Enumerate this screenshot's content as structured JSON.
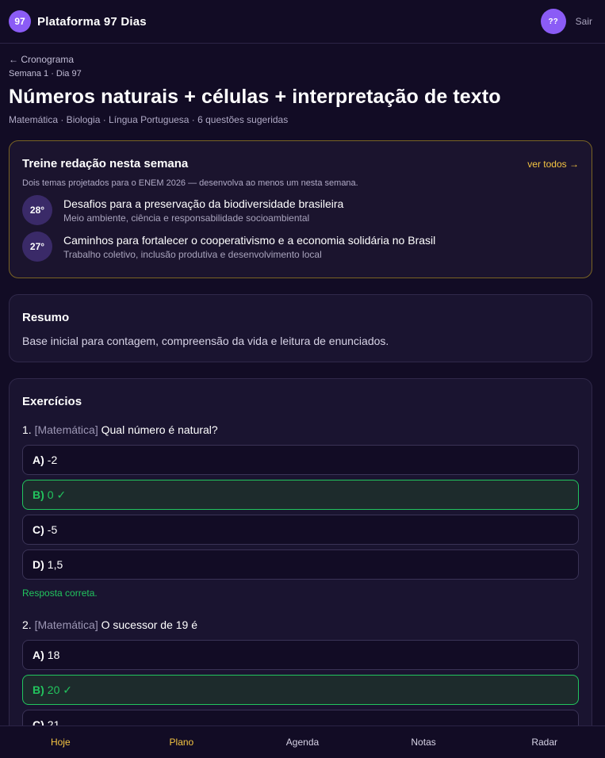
{
  "header": {
    "logo_badge": "97",
    "brand": "Plataforma 97 Dias",
    "avatar": "??",
    "logout": "Sair"
  },
  "page": {
    "back_link": "← Cronograma",
    "breadcrumb": "Semana 1 · Dia 97",
    "title": "Números naturais + células + interpretação de texto",
    "subtitle": "Matemática · Biologia · Língua Portuguesa · 6 questões sugeridas"
  },
  "essay": {
    "title": "Treine redação nesta semana",
    "see_all": "ver todos →",
    "description": "Dois temas projetados para o ENEM 2026 — desenvolva ao menos um nesta semana.",
    "themes": [
      {
        "temp": "28°",
        "title": "Desafios para a preservação da biodiversidade brasileira",
        "sub": "Meio ambiente, ciência e responsabilidade socioambiental"
      },
      {
        "temp": "27°",
        "title": "Caminhos para fortalecer o cooperativismo e a economia solidária no Brasil",
        "sub": "Trabalho coletivo, inclusão produtiva e desenvolvimento local"
      }
    ]
  },
  "summary": {
    "title": "Resumo",
    "text": "Base inicial para contagem, compreensão da vida e leitura de enunciados."
  },
  "exercises": {
    "title": "Exercícios",
    "questions": [
      {
        "number": "1.",
        "subject": "[Matemática]",
        "text": "Qual número é natural?",
        "options": [
          {
            "letter": "A)",
            "text": "-2"
          },
          {
            "letter": "B)",
            "text": "0 ✓"
          },
          {
            "letter": "C)",
            "text": "-5"
          },
          {
            "letter": "D)",
            "text": "1,5"
          }
        ],
        "result": "Resposta correta."
      },
      {
        "number": "2.",
        "subject": "[Matemática]",
        "text": "O sucessor de 19 é",
        "options": [
          {
            "letter": "A)",
            "text": "18"
          },
          {
            "letter": "B)",
            "text": "20 ✓"
          },
          {
            "letter": "C)",
            "text": "21"
          }
        ]
      }
    ]
  },
  "nav": {
    "items": [
      "Hoje",
      "Plano",
      "Agenda",
      "Notas",
      "Radar"
    ]
  },
  "colors": {
    "background": "#120c25",
    "accent_purple": "#8b5cf6",
    "accent_yellow": "#f5c542",
    "correct_green": "#22c55e"
  }
}
